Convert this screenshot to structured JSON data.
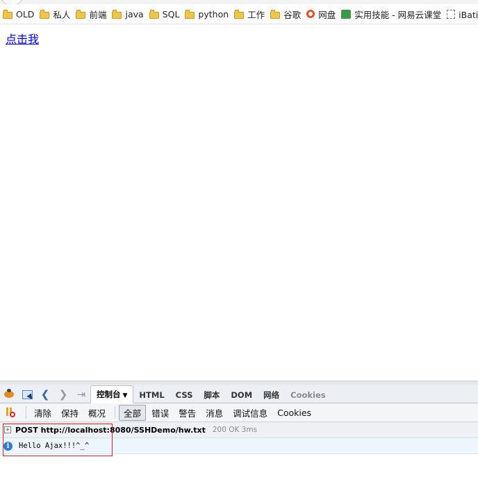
{
  "bookmarks": [
    {
      "icon": "folder-icon",
      "label": "OLD"
    },
    {
      "icon": "folder-icon",
      "label": "私人"
    },
    {
      "icon": "folder-icon",
      "label": "前端"
    },
    {
      "icon": "folder-icon",
      "label": "java"
    },
    {
      "icon": "folder-icon",
      "label": "SQL"
    },
    {
      "icon": "folder-icon",
      "label": "python"
    },
    {
      "icon": "folder-icon",
      "label": "工作"
    },
    {
      "icon": "folder-icon",
      "label": "谷歌"
    },
    {
      "icon": "netdisk-ring-icon",
      "label": "网盘"
    },
    {
      "icon": "green-flag-icon",
      "label": "实用技能 - 网易云课堂"
    },
    {
      "icon": "blank-page-icon",
      "label": "iBatis开"
    }
  ],
  "page": {
    "link_text": "点击我"
  },
  "firebug": {
    "tabs": {
      "console": "控制台",
      "html": "HTML",
      "css": "CSS",
      "script": "脚本",
      "dom": "DOM",
      "net": "网络",
      "cookies": "Cookies"
    },
    "toolbar": {
      "clear": "清除",
      "persist": "保持",
      "profile": "概况",
      "all": "全部",
      "errors": "错误",
      "warnings": "警告",
      "info": "消息",
      "debug": "调试信息",
      "cookies": "Cookies"
    },
    "request": {
      "text": "POST http://localhost:8080/SSHDemo/hw.txt",
      "status": "200 OK 3ms"
    },
    "log": {
      "text": "Hello Ajax!!!^_^"
    }
  }
}
